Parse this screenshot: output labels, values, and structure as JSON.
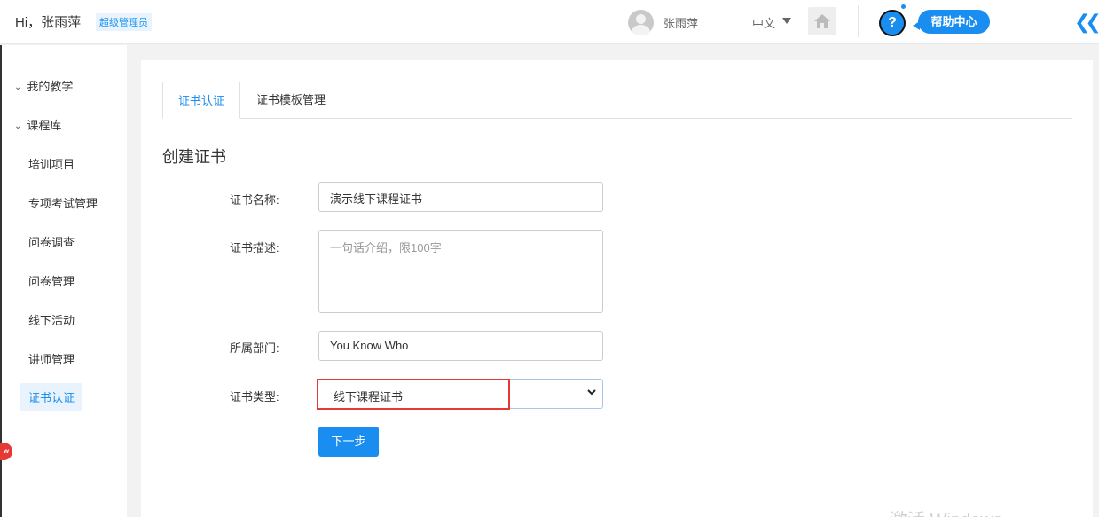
{
  "header": {
    "greeting": "Hi，张雨萍",
    "role_badge": "超级管理员",
    "username": "张雨萍",
    "language": "中文",
    "help_label": "帮助中心",
    "help_icon_glyph": "?",
    "collapse_glyph": "❮❮"
  },
  "sidebar": {
    "groups": [
      {
        "label": "我的教学",
        "icon": "chevron-down-icon"
      },
      {
        "label": "课程库",
        "icon": "chevron-down-icon"
      }
    ],
    "items": [
      {
        "label": "培训项目"
      },
      {
        "label": "专项考试管理"
      },
      {
        "label": "问卷调查"
      },
      {
        "label": "问卷管理"
      },
      {
        "label": "线下活动"
      },
      {
        "label": "讲师管理"
      },
      {
        "label": "证书认证",
        "active": true
      }
    ],
    "new_badge": "w"
  },
  "main": {
    "tabs": [
      {
        "label": "证书认证",
        "active": true
      },
      {
        "label": "证书模板管理"
      }
    ],
    "section_title": "创建证书",
    "form": {
      "name_label": "证书名称:",
      "name_value": "演示线下课程证书",
      "desc_label": "证书描述:",
      "desc_placeholder": "一句话介绍，限100字",
      "dept_label": "所属部门:",
      "dept_value": "You Know Who",
      "type_label": "证书类型:",
      "type_value": "线下课程证书",
      "next_label": "下一步"
    }
  },
  "watermark": "激活 Windows",
  "colors": {
    "accent": "#1a8df0",
    "highlight": "#e53935"
  }
}
